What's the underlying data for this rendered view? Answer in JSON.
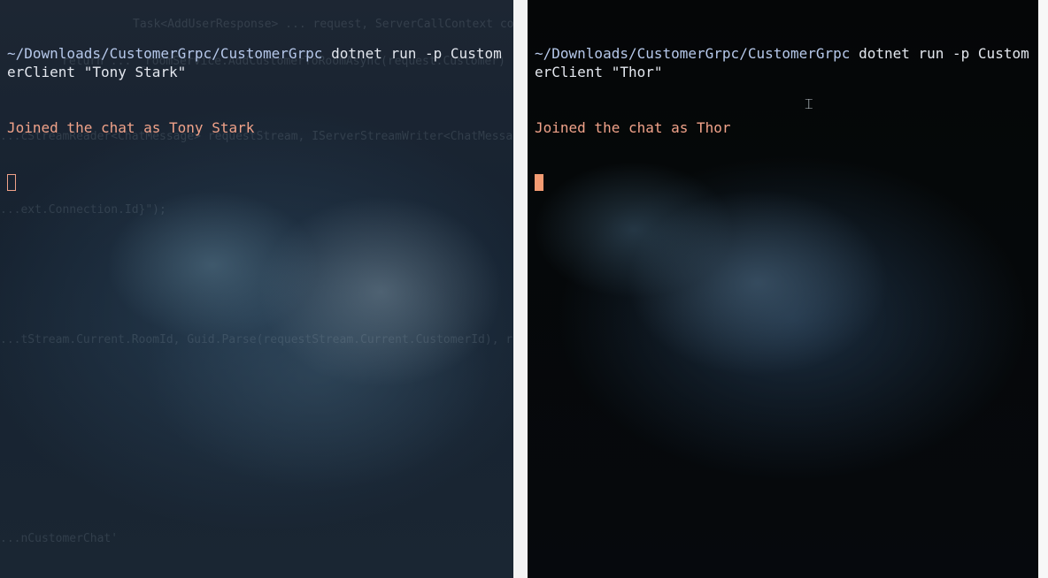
{
  "left_terminal": {
    "path": "~/Downloads/CustomerGrpc",
    "command": "dotnet run -p CustomerClient \"Tony Stark\"",
    "output": "Joined the chat as Tony Stark",
    "background_code": [
      "Task<AddUserResponse> ... request, ServerCallContext context)",
      "return ... _roomService.AddCustomerToRoomAsync(request.Customer) };",
      "...cStreamReader<ChatMessage> requestStream, IServerStreamWriter<ChatMessage> responseStream,",
      "...ext.Connection.Id}\");",
      "...tStream.Current.RoomId, Guid.Parse(requestStream.Current.CustomerId), responseStream);",
      "...nCustomerChat'"
    ]
  },
  "right_terminal": {
    "path": "~/Downloads/CustomerGrpc",
    "command": "dotnet run -p CustomerClient \"Thor\"",
    "output": "Joined the chat as Thor"
  },
  "colors": {
    "path": "#b6c8ea",
    "command": "#e3e7ee",
    "output": "#f0a289",
    "cursor": "#f39b72"
  },
  "icons": {
    "mouse_cursor": "ibeam-icon",
    "terminal_cursor": "block-cursor-icon"
  }
}
